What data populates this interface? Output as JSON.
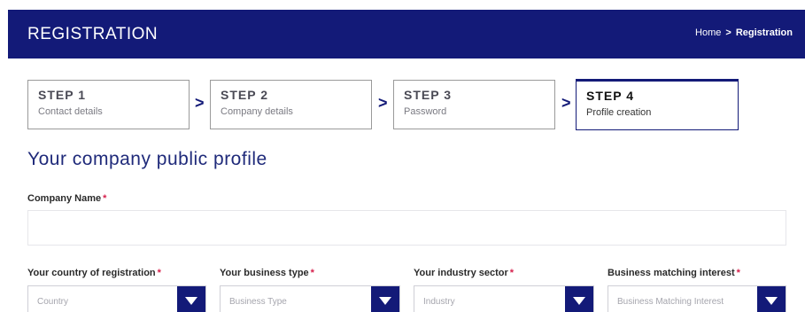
{
  "header": {
    "title": "REGISTRATION",
    "breadcrumb": {
      "home": "Home",
      "separator": ">",
      "current": "Registration"
    }
  },
  "steps": [
    {
      "number": "STEP 1",
      "label": "Contact details"
    },
    {
      "number": "STEP 2",
      "label": "Company details"
    },
    {
      "number": "STEP 3",
      "label": "Password"
    },
    {
      "number": "STEP 4",
      "label": "Profile creation"
    }
  ],
  "step_separator": ">",
  "section_title": "Your company public profile",
  "form": {
    "required_marker": "*",
    "company_name": {
      "label": "Company Name",
      "value": ""
    },
    "country": {
      "label": "Your country of registration",
      "placeholder": "Country"
    },
    "business_type": {
      "label": "Your business type",
      "placeholder": "Business Type"
    },
    "industry_sector": {
      "label": "Your industry sector",
      "placeholder": "Industry"
    },
    "matching_interest": {
      "label": "Business matching interest",
      "placeholder": "Business Matching Interest"
    }
  },
  "colors": {
    "brand": "#131a78",
    "required": "#d6204c"
  },
  "icons": {
    "step_arrow": "chevron-right-icon",
    "select_arrow": "caret-down-icon"
  }
}
